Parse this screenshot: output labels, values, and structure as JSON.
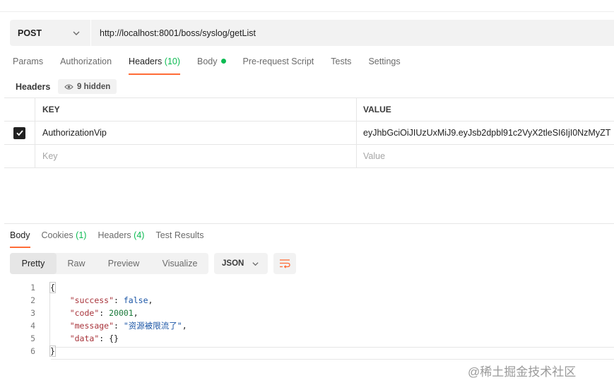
{
  "request": {
    "method": "POST",
    "url": "http://localhost:8001/boss/syslog/getList"
  },
  "request_tabs": [
    {
      "label": "Params",
      "count": ""
    },
    {
      "label": "Authorization",
      "count": ""
    },
    {
      "label": "Headers",
      "count": "(10)"
    },
    {
      "label": "Body",
      "count": ""
    },
    {
      "label": "Pre-request Script",
      "count": ""
    },
    {
      "label": "Tests",
      "count": ""
    },
    {
      "label": "Settings",
      "count": ""
    }
  ],
  "headers_section": {
    "label": "Headers",
    "hidden_label": "9 hidden",
    "columns": [
      "KEY",
      "VALUE"
    ],
    "rows": [
      {
        "checked": true,
        "key": "AuthorizationVip",
        "value": "eyJhbGciOiJIUzUxMiJ9.eyJsb2dpbl91c2VyX2tleSI6IjI0NzMyZT"
      }
    ],
    "placeholder": {
      "key": "Key",
      "value": "Value"
    }
  },
  "response_tabs": [
    {
      "label": "Body",
      "count": ""
    },
    {
      "label": "Cookies",
      "count": "(1)"
    },
    {
      "label": "Headers",
      "count": "(4)"
    },
    {
      "label": "Test Results",
      "count": ""
    }
  ],
  "view_modes": [
    "Pretty",
    "Raw",
    "Preview",
    "Visualize"
  ],
  "format": "JSON",
  "body_lines": {
    "l1": "{",
    "success_key": "\"success\"",
    "success_val": "false",
    "code_key": "\"code\"",
    "code_val": "20001",
    "message_key": "\"message\"",
    "message_val": "\"资源被限流了\"",
    "data_key": "\"data\"",
    "data_val": "{}",
    "l6": "}"
  },
  "line_numbers": [
    "1",
    "2",
    "3",
    "4",
    "5",
    "6"
  ],
  "watermark": "@稀土掘金技术社区",
  "colors": {
    "accent": "#ff6c37",
    "count_green": "#0cbb52"
  }
}
